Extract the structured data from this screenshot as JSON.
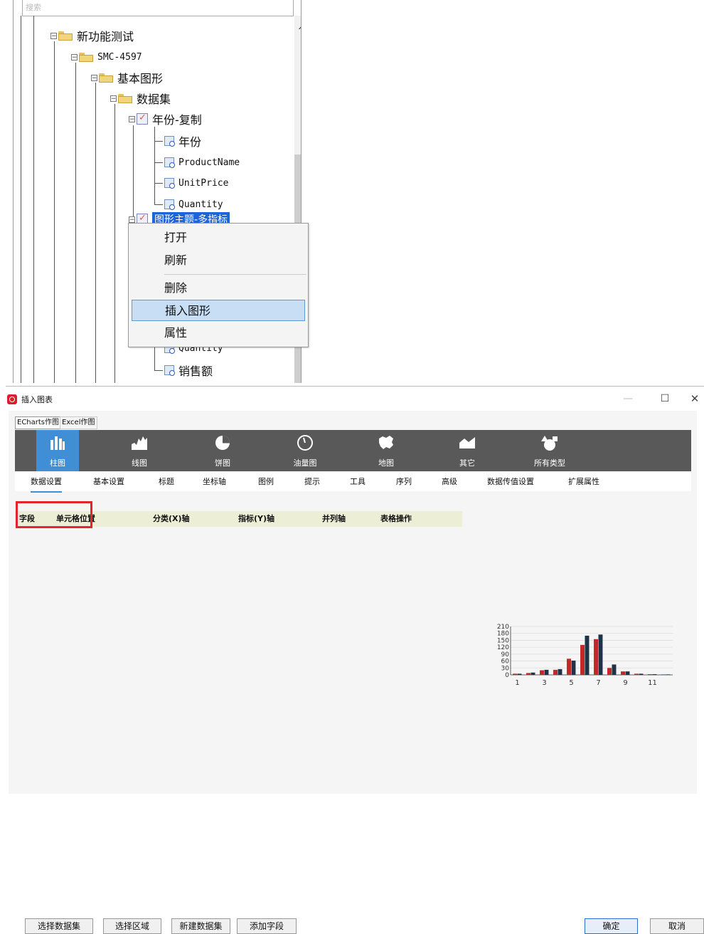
{
  "tree": {
    "search_placeholder": "搜索",
    "nodes": [
      {
        "label": "新功能测试"
      },
      {
        "label": "SMC-4597"
      },
      {
        "label": "基本图形"
      },
      {
        "label": "数据集"
      },
      {
        "label": "年份-复制"
      },
      {
        "label": "年份"
      },
      {
        "label": "ProductName"
      },
      {
        "label": "UnitPrice"
      },
      {
        "label": "Quantity"
      },
      {
        "label": "图形主题-多指标"
      },
      {
        "label": "Quantity"
      },
      {
        "label": "销售额"
      }
    ]
  },
  "context_menu": {
    "items": [
      "打开",
      "刷新",
      "删除",
      "插入图形",
      "属性"
    ],
    "active_index": 3
  },
  "dialog": {
    "title": "插入图表",
    "window_controls": {
      "minimize": "—",
      "maximize": "☐",
      "close": "✕"
    },
    "mode_tabs": [
      "ECharts作图",
      "Excel作图"
    ],
    "chart_types": [
      "柱图",
      "线图",
      "饼图",
      "油量图",
      "地图",
      "其它",
      "所有类型"
    ],
    "active_chart_type": 0,
    "settings_tabs": [
      "数据设置",
      "基本设置",
      "标题",
      "坐标轴",
      "图例",
      "提示",
      "工具",
      "序列",
      "高级",
      "数据传值设置",
      "扩展属性"
    ],
    "active_settings_tab": 0,
    "field_columns": [
      "字段",
      "单元格位置",
      "分类(X)轴",
      "指标(Y)轴",
      "并列轴",
      "表格操作"
    ],
    "buttons": {
      "select_dataset": "选择数据集",
      "select_range": "选择区域",
      "new_dataset": "新建数据集",
      "add_field": "添加字段",
      "ok": "确定",
      "cancel": "取消"
    }
  },
  "chart_data": {
    "type": "bar",
    "x": [
      1,
      2,
      3,
      4,
      5,
      6,
      7,
      8,
      9,
      10,
      11,
      12
    ],
    "x_tick_labels": [
      "1",
      "3",
      "5",
      "7",
      "9",
      "11"
    ],
    "y_tick_labels": [
      "210",
      "180",
      "150",
      "120",
      "90",
      "60",
      "30",
      "0"
    ],
    "ylim": [
      0,
      210
    ],
    "series": [
      {
        "color": "#c0282c",
        "values": [
          5,
          8,
          20,
          22,
          70,
          130,
          155,
          30,
          15,
          5,
          3,
          2
        ]
      },
      {
        "color": "#1f3347",
        "values": [
          5,
          10,
          22,
          25,
          62,
          170,
          175,
          45,
          15,
          5,
          3,
          2
        ]
      }
    ],
    "colors": {
      "series1": "#c0282c",
      "series2": "#1f3347"
    },
    "grid": true
  }
}
